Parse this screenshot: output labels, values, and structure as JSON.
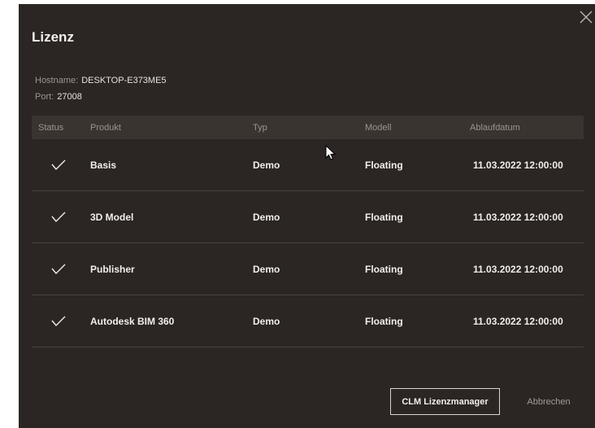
{
  "dialog": {
    "title": "Lizenz",
    "hostname_label": "Hostname:",
    "hostname_value": "DESKTOP-E373ME5",
    "port_label": "Port:",
    "port_value": "27008"
  },
  "table": {
    "headers": {
      "status": "Status",
      "produkt": "Produkt",
      "typ": "Typ",
      "modell": "Modell",
      "ablaufdatum": "Ablaufdatum"
    },
    "rows": [
      {
        "status_icon": "checkmark-icon",
        "produkt": "Basis",
        "typ": "Demo",
        "modell": "Floating",
        "ablaufdatum": "11.03.2022 12:00:00"
      },
      {
        "status_icon": "checkmark-icon",
        "produkt": "3D Model",
        "typ": "Demo",
        "modell": "Floating",
        "ablaufdatum": "11.03.2022 12:00:00"
      },
      {
        "status_icon": "checkmark-icon",
        "produkt": "Publisher",
        "typ": "Demo",
        "modell": "Floating",
        "ablaufdatum": "11.03.2022 12:00:00"
      },
      {
        "status_icon": "checkmark-icon",
        "produkt": "Autodesk BIM 360",
        "typ": "Demo",
        "modell": "Floating",
        "ablaufdatum": "11.03.2022 12:00:00"
      }
    ]
  },
  "buttons": {
    "clm_label": "CLM Lizenzmanager",
    "cancel_label": "Abbrechen"
  },
  "icons": {
    "close": "close-icon",
    "status_ok": "checkmark-icon",
    "cursor": "mouse-pointer-icon"
  },
  "colors": {
    "background": "#2b2523",
    "header_bg": "#3a3431",
    "text": "#f1efec",
    "muted": "#9a9592"
  }
}
